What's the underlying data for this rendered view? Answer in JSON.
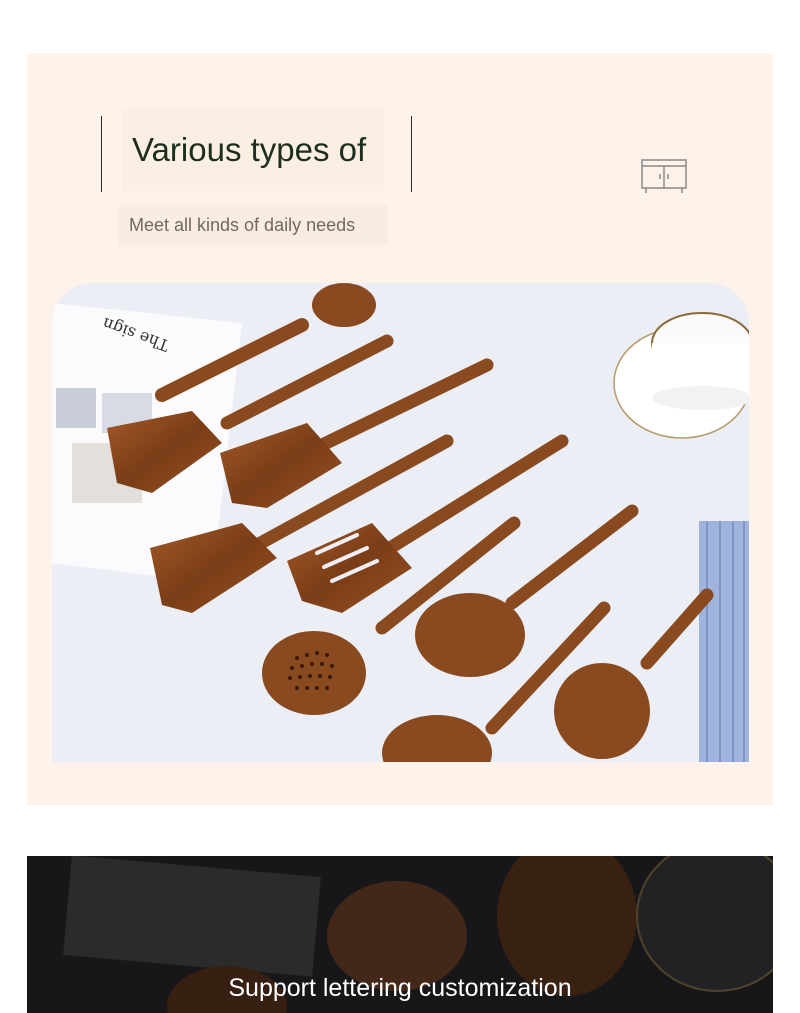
{
  "header": {
    "title": "Various types of",
    "subtitle": "Meet all kinds of daily needs",
    "icon": "cabinet-icon"
  },
  "photo": {
    "book_text": "The sign",
    "wood_color": "#8a4a1f",
    "cloth_color": "#8da5d4"
  },
  "banner": {
    "text": "Support lettering customization"
  }
}
